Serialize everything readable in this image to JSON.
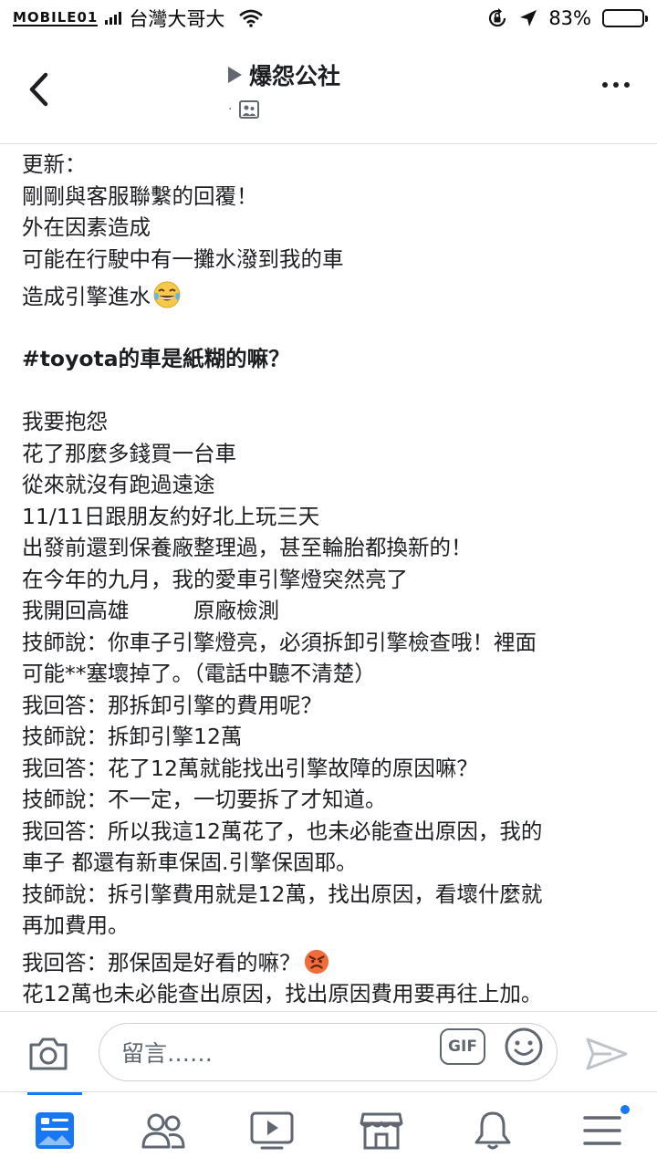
{
  "status_bar": {
    "watermark": "MOBILE01",
    "carrier": "台灣大哥大",
    "battery_percent": "83%",
    "battery_level": 0.83
  },
  "header": {
    "title": "爆怨公社",
    "subtitle_dot": "·"
  },
  "post": {
    "lines": [
      "更新：",
      "剛剛與客服聯繫的回覆！",
      "外在因素造成",
      "可能在行駛中有一攤水潑到我的車",
      "造成引擎進水",
      "",
      "#toyota的車是紙糊的嘛？",
      "",
      "我要抱怨",
      "花了那麼多錢買一台車",
      "從來就沒有跑過遠途",
      "11/11日跟朋友約好北上玩三天",
      "出發前還到保養廠整理過，甚至輪胎都換新的！",
      "在今年的九月，我的愛車引擎燈突然亮了",
      "我開回高雄　　　原廠檢測",
      "技師說：你車子引擎燈亮，必須拆卸引擎檢查哦！裡面",
      "可能**塞壞掉了。（電話中聽不清楚）",
      "我回答：那拆卸引擎的費用呢？",
      "技師說：拆卸引擎12萬",
      "我回答：花了12萬就能找出引擎故障的原因嘛？",
      "技師說：不一定，一切要拆了才知道。",
      "我回答：所以我這12萬花了，也未必能查出原因，我的",
      "車子 都還有新車保固.引擎保固耶。",
      "技師說：拆引擎費用就是12萬，找出原因，看壞什麼就",
      "再加費用。",
      "我回答：那保固是好看的嘛？",
      "花12萬也未必能查出原因，找出原因費用要再往上加。"
    ]
  },
  "comment_bar": {
    "placeholder": "留言……",
    "gif_label": "GIF"
  },
  "colors": {
    "accent": "#1877f2",
    "icon_gray": "#606770",
    "text": "#1c1e21"
  }
}
